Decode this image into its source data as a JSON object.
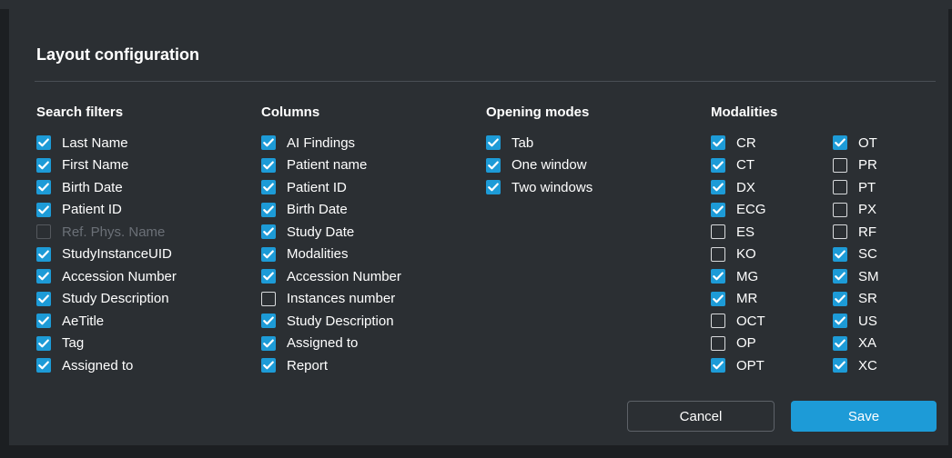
{
  "dialog": {
    "title": "Layout configuration",
    "cancel_label": "Cancel",
    "save_label": "Save"
  },
  "search_filters": {
    "title": "Search filters",
    "items": [
      {
        "label": "Last Name",
        "checked": true,
        "disabled": false
      },
      {
        "label": "First Name",
        "checked": true,
        "disabled": false
      },
      {
        "label": "Birth Date",
        "checked": true,
        "disabled": false
      },
      {
        "label": "Patient ID",
        "checked": true,
        "disabled": false
      },
      {
        "label": "Ref. Phys. Name",
        "checked": false,
        "disabled": true
      },
      {
        "label": "StudyInstanceUID",
        "checked": true,
        "disabled": false
      },
      {
        "label": "Accession Number",
        "checked": true,
        "disabled": false
      },
      {
        "label": "Study Description",
        "checked": true,
        "disabled": false
      },
      {
        "label": "AeTitle",
        "checked": true,
        "disabled": false
      },
      {
        "label": "Tag",
        "checked": true,
        "disabled": false
      },
      {
        "label": "Assigned to",
        "checked": true,
        "disabled": false
      }
    ]
  },
  "columns": {
    "title": "Columns",
    "items": [
      {
        "label": "AI Findings",
        "checked": true
      },
      {
        "label": "Patient name",
        "checked": true
      },
      {
        "label": "Patient ID",
        "checked": true
      },
      {
        "label": "Birth Date",
        "checked": true
      },
      {
        "label": "Study Date",
        "checked": true
      },
      {
        "label": "Modalities",
        "checked": true
      },
      {
        "label": "Accession Number",
        "checked": true
      },
      {
        "label": "Instances number",
        "checked": false
      },
      {
        "label": "Study Description",
        "checked": true
      },
      {
        "label": "Assigned to",
        "checked": true
      },
      {
        "label": "Report",
        "checked": true
      }
    ]
  },
  "opening_modes": {
    "title": "Opening modes",
    "items": [
      {
        "label": "Tab",
        "checked": true
      },
      {
        "label": "One window",
        "checked": true
      },
      {
        "label": "Two windows",
        "checked": true
      }
    ]
  },
  "modalities": {
    "title": "Modalities",
    "left": [
      {
        "label": "CR",
        "checked": true
      },
      {
        "label": "CT",
        "checked": true
      },
      {
        "label": "DX",
        "checked": true
      },
      {
        "label": "ECG",
        "checked": true
      },
      {
        "label": "ES",
        "checked": false
      },
      {
        "label": "KO",
        "checked": false
      },
      {
        "label": "MG",
        "checked": true
      },
      {
        "label": "MR",
        "checked": true
      },
      {
        "label": "OCT",
        "checked": false
      },
      {
        "label": "OP",
        "checked": false
      },
      {
        "label": "OPT",
        "checked": true
      }
    ],
    "right": [
      {
        "label": "OT",
        "checked": true
      },
      {
        "label": "PR",
        "checked": false
      },
      {
        "label": "PT",
        "checked": false
      },
      {
        "label": "PX",
        "checked": false
      },
      {
        "label": "RF",
        "checked": false
      },
      {
        "label": "SC",
        "checked": true
      },
      {
        "label": "SM",
        "checked": true
      },
      {
        "label": "SR",
        "checked": true
      },
      {
        "label": "US",
        "checked": true
      },
      {
        "label": "XA",
        "checked": true
      },
      {
        "label": "XC",
        "checked": true
      }
    ]
  },
  "colors": {
    "accent": "#1d9bd7",
    "dialog_bg": "#2b2f33",
    "text": "#ffffff",
    "disabled_text": "#6b7077"
  },
  "icons": {
    "checkbox_checked": "checkmark-icon"
  }
}
